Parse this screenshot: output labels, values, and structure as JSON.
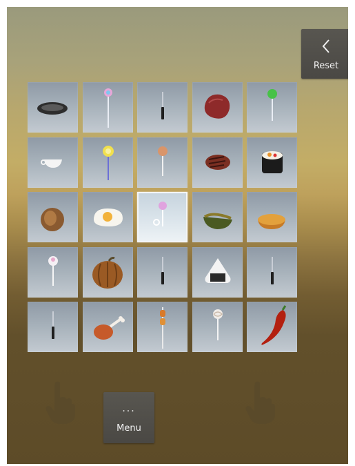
{
  "reset_button": {
    "label": "Reset",
    "icon": "chevron-left-icon"
  },
  "menu_button": {
    "dots": "...",
    "label": "Menu"
  },
  "colors": {
    "button_bg": "#4f4d49",
    "tile": "#a5b0b9",
    "tile_selected": "#dfe7ee",
    "hand": "#5f5030"
  },
  "hands": [
    {
      "side": "left",
      "icon": "hand-pointer-icon"
    },
    {
      "side": "right",
      "icon": "hand-pointer-icon"
    }
  ],
  "grid": {
    "rows": 5,
    "cols": 5,
    "selected_index": 12,
    "items": [
      "plate",
      "lollipop-rainbow",
      "knife",
      "meat-steak",
      "lollipop-green",
      "teacup",
      "lollipop-yellow",
      "lollipop-peach",
      "grilled-steak",
      "sushi-roll",
      "bread-roll",
      "fried-egg",
      "lollipop-pink",
      "avocado-half",
      "orange-half",
      "lollipop-white",
      "pumpkin",
      "knife",
      "onigiri",
      "knife",
      "knife",
      "chicken-drumstick",
      "skewer-kebab",
      "lollipop-swirl",
      "red-chili-pepper"
    ]
  }
}
